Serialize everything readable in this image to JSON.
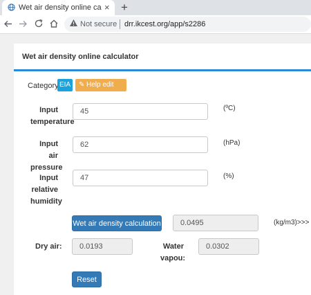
{
  "browser": {
    "tab_title": "Wet air density online calculator",
    "close_glyph": "×",
    "new_tab_glyph": "+",
    "security_label": "Not secure",
    "url": "drr.ikcest.org/app/s2286"
  },
  "page": {
    "title": "Wet air density online calculator",
    "category_label": "Category:",
    "category_badge": "EIA",
    "help_edit_label": "Help edit"
  },
  "form": {
    "temperature": {
      "label": "Input temperature",
      "value": "45",
      "unit": "(ºC)"
    },
    "pressure": {
      "label": "Input air pressure",
      "value": "62",
      "unit": "(hPa)"
    },
    "humidity": {
      "label": "Input relative humidity",
      "value": "47",
      "unit": "(%)"
    },
    "calc_button": "Wet air density calculation",
    "result_value": "0.0495",
    "result_unit": "(kg/m3)>>>",
    "dry_air_label": "Dry air:",
    "dry_air_value": "0.0193",
    "water_vapor_label": "Water vapou:",
    "water_vapor_value": "0.0302",
    "reset_button": "Reset"
  },
  "colors": {
    "accent": "#2a8ad6",
    "button": "#337ab7",
    "badge": "#19a2dc",
    "help": "#f0ad4e"
  },
  "icons": [
    "globe-icon",
    "back-arrow-icon",
    "forward-arrow-icon",
    "reload-icon",
    "home-icon",
    "warning-icon",
    "pencil-icon"
  ]
}
